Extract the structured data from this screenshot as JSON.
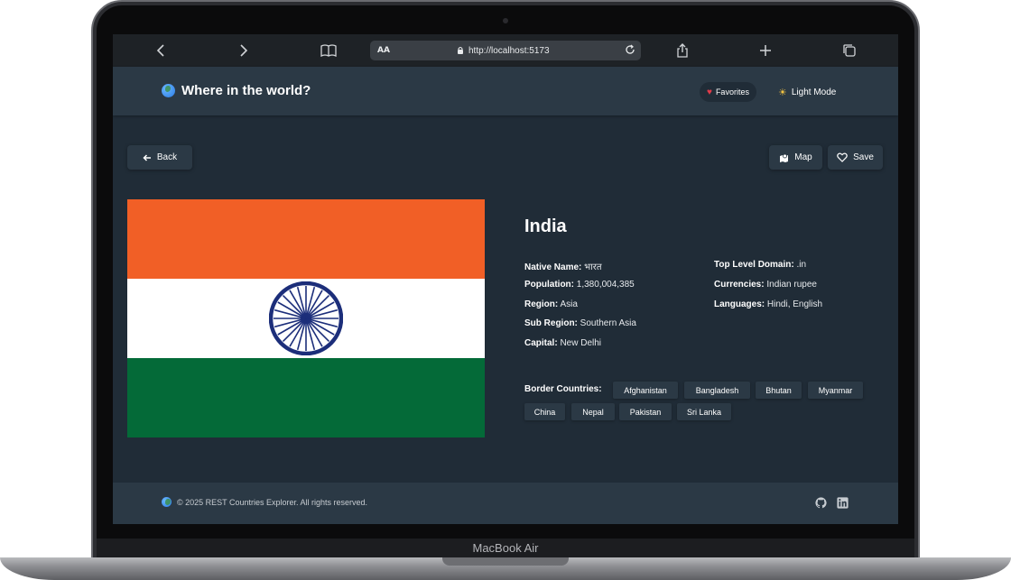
{
  "device": {
    "label": "MacBook Air"
  },
  "browser": {
    "text_size_label": "AA",
    "url": "http://localhost:5173",
    "icons": [
      "chevron-left-icon",
      "chevron-right-icon",
      "book-icon",
      "lock-icon",
      "reload-icon",
      "share-icon",
      "plus-icon",
      "tabs-icon"
    ]
  },
  "header": {
    "title": "Where in the world?",
    "favorites_label": "Favorites",
    "theme_label": "Light Mode"
  },
  "actions": {
    "back_label": "Back",
    "map_label": "Map",
    "save_label": "Save"
  },
  "country": {
    "name": "India",
    "flag_colors": {
      "saffron": "#f15f26",
      "white": "#ffffff",
      "green": "#046a38",
      "chakra": "#1c2e7a"
    },
    "left_details": [
      {
        "key": "Native Name:",
        "value": "भारत"
      },
      {
        "key": "Population:",
        "value": "1,380,004,385"
      },
      {
        "key": "Region:",
        "value": "Asia"
      },
      {
        "key": "Sub Region:",
        "value": "Southern Asia"
      },
      {
        "key": "Capital:",
        "value": "New Delhi"
      }
    ],
    "right_details": [
      {
        "key": "Top Level Domain:",
        "value": ".in"
      },
      {
        "key": "Currencies:",
        "value": "Indian rupee"
      },
      {
        "key": "Languages:",
        "value": "Hindi, English"
      }
    ],
    "border_label": "Border Countries:",
    "borders": [
      "Afghanistan",
      "Bangladesh",
      "Bhutan",
      "Myanmar",
      "China",
      "Nepal",
      "Pakistan",
      "Sri Lanka"
    ]
  },
  "footer": {
    "copyright": "© 2025 REST Countries Explorer. All rights reserved."
  },
  "theme": {
    "background": "#202c37",
    "surface": "#2b3945",
    "text": "#ffffff"
  }
}
